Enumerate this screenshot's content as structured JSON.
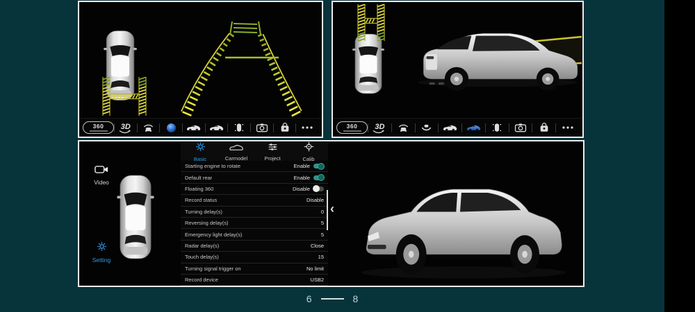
{
  "colors": {
    "background": "#07333a",
    "panel_border": "#ededed",
    "accent_blue": "#2e9bea",
    "toggle_on": "#2f9488",
    "guide_yellow": "#ddd73c",
    "guide_green": "#8fae24",
    "pagination_text": "#b9d6d6"
  },
  "top_left_panel": {
    "toolbar": [
      {
        "name": "view-360",
        "label": "360",
        "icon": "badge360",
        "active": false
      },
      {
        "name": "view-3d",
        "label": "3D",
        "icon": "badge3d",
        "active": false
      },
      {
        "name": "front-camera-view",
        "icon": "frontcam",
        "active": false
      },
      {
        "name": "bowl-view",
        "icon": "bowl",
        "active": true
      },
      {
        "name": "car-side-view",
        "icon": "carside",
        "active": false
      },
      {
        "name": "car-3d-view",
        "icon": "carside2",
        "active": false
      },
      {
        "name": "radar-view",
        "icon": "radarcar",
        "active": false
      },
      {
        "name": "snapshot-camera",
        "icon": "camera",
        "active": false
      },
      {
        "name": "dvr-bag",
        "icon": "bag",
        "active": false
      },
      {
        "name": "more-options",
        "icon": "more",
        "active": false
      }
    ]
  },
  "top_right_panel": {
    "toolbar": [
      {
        "name": "view-360",
        "label": "360",
        "icon": "badge360",
        "active": false
      },
      {
        "name": "view-3d",
        "label": "3D",
        "icon": "badge3d",
        "active": false
      },
      {
        "name": "front-camera-view",
        "icon": "frontcam",
        "active": false
      },
      {
        "name": "bowl-view",
        "icon": "bowl",
        "active": false
      },
      {
        "name": "car-side-view",
        "icon": "carside",
        "active": false
      },
      {
        "name": "car-3d-view",
        "icon": "carside2",
        "active": true
      },
      {
        "name": "radar-view",
        "icon": "radarcar",
        "active": false
      },
      {
        "name": "snapshot-camera",
        "icon": "camera",
        "active": false
      },
      {
        "name": "dvr-bag",
        "icon": "bag",
        "active": false
      },
      {
        "name": "more-options",
        "icon": "more",
        "active": false
      }
    ]
  },
  "settings_panel": {
    "sidebar": [
      {
        "label": "Video",
        "icon": "videocam",
        "active": false
      },
      {
        "label": "Setting",
        "icon": "gear",
        "active": true
      }
    ],
    "tabs": [
      {
        "label": "Basic",
        "icon": "gear",
        "active": true
      },
      {
        "label": "Carmodel",
        "icon": "caroutline",
        "active": false
      },
      {
        "label": "Project",
        "icon": "sliders",
        "active": false
      },
      {
        "label": "Calib",
        "icon": "crosshair",
        "active": false
      }
    ],
    "rows": [
      {
        "label": "Starting engine to rotate",
        "value": "Enable",
        "toggle": "on"
      },
      {
        "label": "Default rear",
        "value": "Enable",
        "toggle": "on"
      },
      {
        "label": "Floating 360",
        "value": "Disable",
        "toggle": "off"
      },
      {
        "label": "Record status",
        "value": "Disable"
      },
      {
        "label": "Turning delay(s)",
        "value": "0"
      },
      {
        "label": "Reversing delay(s)",
        "value": "5"
      },
      {
        "label": "Emergency light delay(s)",
        "value": "5"
      },
      {
        "label": "Radar delay(s)",
        "value": "Close"
      },
      {
        "label": "Touch delay(s)",
        "value": "15"
      },
      {
        "label": "Turning signal trigger on",
        "value": "No limit"
      },
      {
        "label": "Record device",
        "value": "USB2"
      }
    ],
    "collapse_arrow": "‹"
  },
  "pagination": {
    "current": "6",
    "total": "8"
  }
}
